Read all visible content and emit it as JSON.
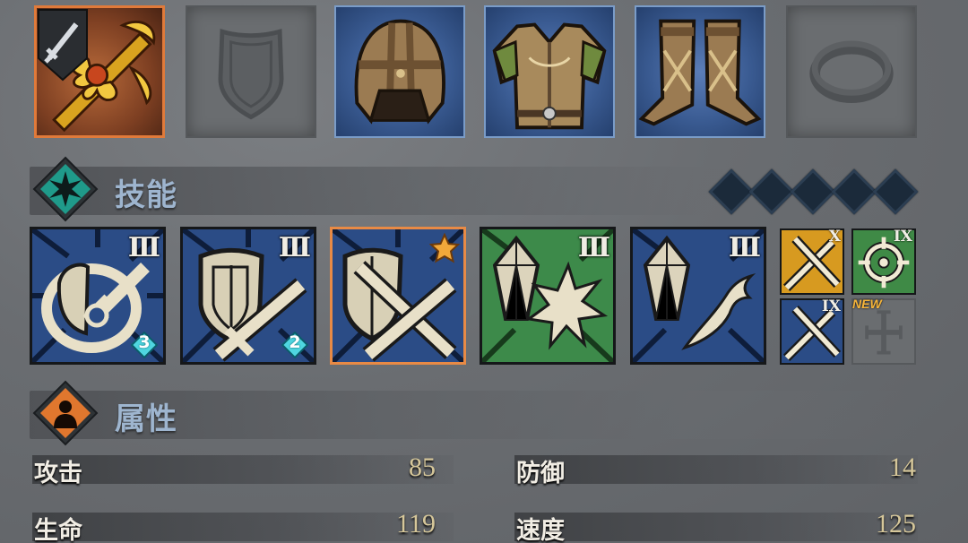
{
  "equipment": [
    {
      "slot": "weapon",
      "state": "equipped",
      "rarity": "orange",
      "icon": "golden-sword-icon",
      "badge_icon": "dagger-shield-icon"
    },
    {
      "slot": "offhand",
      "state": "empty",
      "icon": "shield-outline-icon"
    },
    {
      "slot": "helmet",
      "state": "equipped",
      "rarity": "blue",
      "icon": "leather-helmet-icon"
    },
    {
      "slot": "armor",
      "state": "equipped",
      "rarity": "blue",
      "icon": "leather-armor-icon"
    },
    {
      "slot": "boots",
      "state": "equipped",
      "rarity": "blue",
      "icon": "leather-boots-icon"
    },
    {
      "slot": "ring",
      "state": "empty",
      "icon": "ring-outline-icon"
    }
  ],
  "skills_section": {
    "title": "技能",
    "icon": "star-diamond-icon",
    "slot_diamonds": 5,
    "skills": [
      {
        "icon": "shield-sword-spin-icon",
        "tier": "III",
        "gem_count": "3",
        "bg": "blue",
        "selected": false
      },
      {
        "icon": "shield-sword-cross-icon",
        "tier": "III",
        "gem_count": "2",
        "bg": "blue",
        "selected": false
      },
      {
        "icon": "shield-sword-cross-icon",
        "tier": "",
        "star": true,
        "bg": "blue",
        "selected": true
      },
      {
        "icon": "crystal-burst-icon",
        "tier": "III",
        "bg": "green",
        "selected": false
      },
      {
        "icon": "crystal-dash-icon",
        "tier": "III",
        "bg": "blue",
        "selected": false
      }
    ],
    "minis": [
      {
        "icon": "crossed-swords-icon",
        "tier": "X",
        "bg": "gold"
      },
      {
        "icon": "crosshair-icon",
        "tier": "IX",
        "bg": "green"
      },
      {
        "icon": "crossed-swords-icon",
        "tier": "IX",
        "bg": "blue"
      },
      {
        "icon": "cross-placeholder-icon",
        "tier": "",
        "bg": "empty",
        "badge": "NEW"
      }
    ],
    "colors": {
      "accent": "#1f9a8a",
      "selected_border": "#e88a45"
    }
  },
  "attributes_section": {
    "title": "属性",
    "icon": "person-silhouette-icon",
    "stats": [
      {
        "label": "攻击",
        "value": "85"
      },
      {
        "label": "防御",
        "value": "14"
      },
      {
        "label": "生命",
        "value": "119"
      },
      {
        "label": "速度",
        "value": "125"
      }
    ],
    "colors": {
      "accent": "#e0772e"
    }
  }
}
